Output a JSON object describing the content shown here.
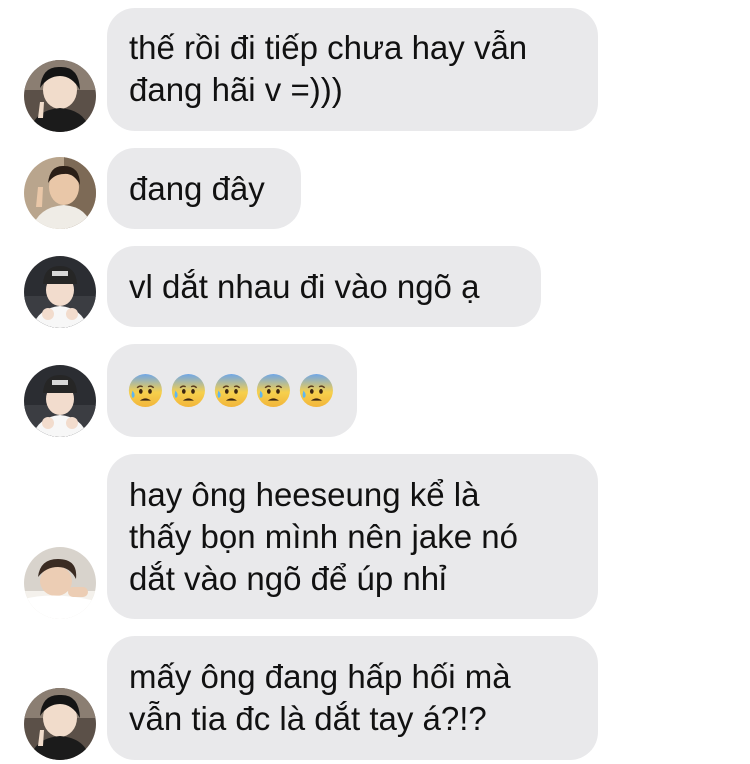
{
  "messages": [
    {
      "type": "text",
      "avatar": "avatar-dark-hair-peace-sign",
      "lines": [
        "thế rồi đi tiếp chưa hay vẫn",
        "đang hãi v =)))"
      ]
    },
    {
      "type": "text",
      "avatar": "avatar-peace-sign-white-shirt",
      "lines": [
        "đang đây"
      ]
    },
    {
      "type": "text",
      "avatar": "avatar-beanie-hands",
      "lines": [
        "vl dắt nhau đi vào ngõ ạ"
      ]
    },
    {
      "type": "emoji",
      "avatar": "avatar-beanie-hands",
      "emojis": [
        "anxious-face-with-sweat-emoji",
        "anxious-face-with-sweat-emoji",
        "anxious-face-with-sweat-emoji",
        "anxious-face-with-sweat-emoji",
        "anxious-face-with-sweat-emoji"
      ]
    },
    {
      "type": "text",
      "avatar": "avatar-lying-down",
      "lines": [
        "hay ông heeseung kể là",
        "thấy bọn mình nên jake nó",
        "dắt vào ngõ để úp nhỉ"
      ]
    },
    {
      "type": "text",
      "avatar": "avatar-dark-hair-peace-sign",
      "lines": [
        "mấy ông đang hấp hối mà",
        "vẫn tia đc là dắt tay á?!?"
      ]
    }
  ],
  "colors": {
    "bubble": "#e9e9eb",
    "text": "#111111",
    "background": "#ffffff"
  }
}
